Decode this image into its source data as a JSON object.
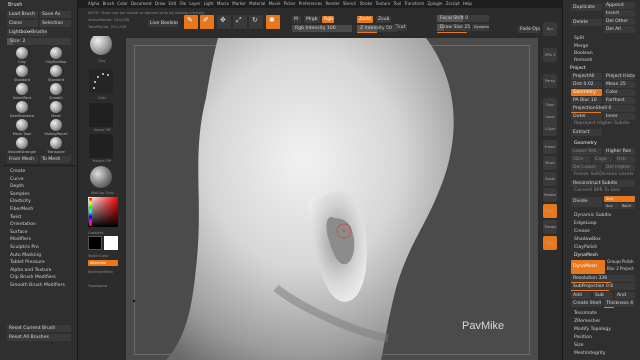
{
  "top_menu": [
    "Alpha",
    "Brush",
    "Color",
    "Document",
    "Draw",
    "Edit",
    "File",
    "Layer",
    "Light",
    "Macro",
    "Marker",
    "Material",
    "Movie",
    "Picker",
    "Preferences",
    "Render",
    "Stencil",
    "Stroke",
    "Texture",
    "Tool",
    "Transform",
    "Zplugin",
    "Zscript",
    "Help"
  ],
  "top_left": {
    "active_points": "ActivePoints: 194,058",
    "total_points": "TotalPoints: 201,026",
    "note": "NOTE: Trays can be closed or opened only by double-clicking.",
    "live_boolean": "Live Boolean"
  },
  "toolbar": {
    "edit": "Edit",
    "draw": "Draw",
    "move": "Move",
    "scale": "Scale",
    "rotate": "Rotate",
    "m": "M",
    "mrgb": "Mrgb",
    "rgb": "Rgb",
    "zadd": "Zadd",
    "zsub": "Zsub",
    "zcut": "Zcut",
    "rgb_intensity": "Rgb Intensity 100",
    "z_intensity": "Z Intensity 50",
    "focal_shift": "Focal Shift 0",
    "draw_size": "Draw Size 25",
    "dynamic": "Dynamic",
    "active_points": "ActivePoints: 194,058",
    "total_points": "TotalPoints: 201,026",
    "fade_opacity": "Fade Opacity 0"
  },
  "left": {
    "title": "Brush",
    "buttons": [
      "Load Brush",
      "Save As",
      "Clone",
      "Selection",
      "Lightbox▸Brushes"
    ],
    "size_label": "Size: 2",
    "brushes": [
      "Clay",
      "ClayBuildup",
      "Standard",
      "Standard",
      "SelectRect",
      "Smooth",
      "DamStandard",
      "Move",
      "Move Topo",
      "HistoryRecall",
      "SmoothStronger",
      "Transpose"
    ],
    "from_mesh": "From Mesh",
    "to_mesh": "To Mesh",
    "menu": [
      "Create",
      "Curve",
      "Depth",
      "Samples",
      "Elasticity",
      "FiberMesh",
      "Twist",
      "Orientation",
      "Surface",
      "Modifiers",
      "Sculptris Pro",
      "Auto Masking",
      "Tablet Pressure",
      "Alpha and Texture",
      "Clip Brush Modifiers",
      "Smooth Brush Modifiers"
    ],
    "reset_current": "Reset Current Brush",
    "reset_all": "Reset All Brushes"
  },
  "palette": {
    "dots_label": "Dots",
    "alpha_label": "Alpha Off",
    "texture_label": "Texture Off",
    "matcap_label": "MatCap Gray",
    "gradient": "Gradient",
    "switch_color": "SwitchColor",
    "alternate": "Alternate",
    "backface": "BackfaceMask",
    "topological": "Topological"
  },
  "right_icons": [
    "Bpr",
    "SPix 3",
    "Persp",
    "Floor",
    "Local",
    "L.Sym",
    "Frame",
    "Move",
    "Scale",
    "Rotate",
    "PolyF",
    "Transp",
    "Solo"
  ],
  "right": {
    "top_buttons": [
      "Duplicate",
      "Append",
      "Insert",
      "Delete",
      "Del Other",
      "Del All"
    ],
    "mid_buttons": [
      "Split",
      "Merge",
      "Boolean",
      "Remesh"
    ],
    "project_header": "Project",
    "project_rows": [
      "ProjectAll",
      "Project History",
      "Dist 0.02",
      "Mean 25",
      "Geometry",
      "Color",
      "PA Blur 10",
      "Farthest",
      "ProjectionShell 0",
      "Outer",
      "Inner",
      "Reproject Higher Subdiv",
      "Extract"
    ],
    "geometry_header": "Geometry",
    "geo_rows": [
      "Lower Res",
      "Higher Res",
      "SDiv",
      "Cage",
      "Rstr",
      "Del Lower",
      "Del Higher",
      "Freeze SubDivision Levels",
      "Reconstruct Subdiv",
      "Convert BPR To Geo",
      "Divide",
      "Smt",
      "Suv",
      "ReUV"
    ],
    "geo_list": [
      "Dynamic Subdiv",
      "EdgeLoop",
      "Crease",
      "ShadowBox",
      "ClayPolish"
    ],
    "dynamesh_header": "DynaMesh",
    "dynamesh_rows": [
      "DynaMesh",
      "Groups",
      "Polish",
      "Blur 2",
      "Project",
      "Resolution 336",
      "SubProjection 0.6",
      "Add",
      "Sub",
      "And",
      "Create Shell",
      "Thickness 4"
    ],
    "tail": [
      "Tessimate",
      "ZRemesher",
      "Modify Topology",
      "Position",
      "Size",
      "MeshIntegrity"
    ]
  },
  "watermark": "PavMike",
  "colors": {
    "accent": "#e8781e",
    "bg": "#2a2a2a",
    "panel": "#333333",
    "button": "#3a3a3a"
  }
}
